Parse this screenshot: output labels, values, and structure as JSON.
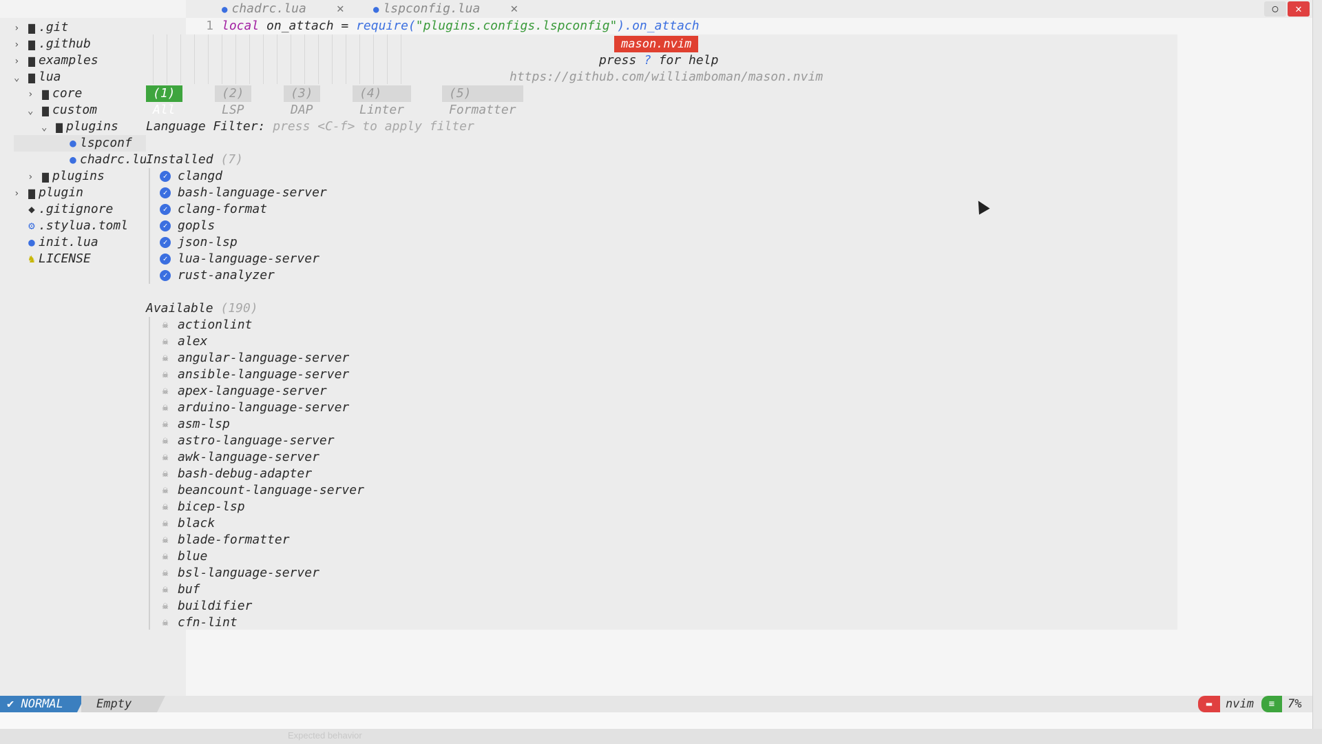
{
  "tabs": [
    {
      "label": "chadrc.lua",
      "icon": "lua-icon",
      "close": "✕"
    },
    {
      "label": "lspconfig.lua",
      "icon": "lua-icon",
      "close": "✕"
    }
  ],
  "editor": {
    "line_number": "1",
    "code": {
      "keyword": "local",
      "var": " on_attach = ",
      "fn": "require(",
      "str": "\"plugins.configs.lspconfig\"",
      "rest": ").on_attach"
    }
  },
  "tree": [
    {
      "label": ".git",
      "arrow": "›",
      "icon": "folder-icon"
    },
    {
      "label": ".github",
      "arrow": "›",
      "icon": "folder-icon"
    },
    {
      "label": "examples",
      "arrow": "›",
      "icon": "folder-icon"
    },
    {
      "label": "lua",
      "arrow": "⌄",
      "icon": "folder-icon"
    },
    {
      "label": "core",
      "arrow": "›",
      "icon": "folder-icon"
    },
    {
      "label": "custom",
      "arrow": "⌄",
      "icon": "folder-icon"
    },
    {
      "label": "plugins",
      "arrow": "⌄",
      "icon": "folder-icon"
    },
    {
      "label": "lspconf",
      "arrow": "",
      "icon": "lua-icon"
    },
    {
      "label": "chadrc.lu",
      "arrow": "",
      "icon": "lua-icon"
    },
    {
      "label": "plugins",
      "arrow": "›",
      "icon": "folder-icon"
    },
    {
      "label": "plugin",
      "arrow": "›",
      "icon": "folder-icon"
    },
    {
      "label": ".gitignore",
      "arrow": "",
      "icon": "git-icon"
    },
    {
      "label": ".stylua.toml",
      "arrow": "",
      "icon": "gear-icon"
    },
    {
      "label": "init.lua",
      "arrow": "",
      "icon": "lua-icon"
    },
    {
      "label": "LICENSE",
      "arrow": "",
      "icon": "license-icon"
    }
  ],
  "mason": {
    "title": "mason.nvim",
    "help_prefix": "press ",
    "help_key": "?",
    "help_suffix": " for help",
    "url": "https://github.com/williamboman/mason.nvim",
    "tabs": [
      "(1) All",
      "(2) LSP",
      "(3) DAP",
      "(4) Linter",
      "(5) Formatter"
    ],
    "active_tab": 0,
    "filter_label": "Language Filter:",
    "filter_hint": "press <C-f> to apply filter",
    "installed_label": "Installed",
    "installed_count": "(7)",
    "installed": [
      "clangd",
      "bash-language-server",
      "clang-format",
      "gopls",
      "json-lsp",
      "lua-language-server",
      "rust-analyzer"
    ],
    "available_label": "Available",
    "available_count": "(190)",
    "available": [
      "actionlint",
      "alex",
      "angular-language-server",
      "ansible-language-server",
      "apex-language-server",
      "arduino-language-server",
      "asm-lsp",
      "astro-language-server",
      "awk-language-server",
      "bash-debug-adapter",
      "beancount-language-server",
      "bicep-lsp",
      "black",
      "blade-formatter",
      "blue",
      "bsl-language-server",
      "buf",
      "buildifier",
      "cfn-lint"
    ]
  },
  "statusline": {
    "mode": "NORMAL",
    "buffer": "Empty",
    "app": "nvim",
    "percent": "7%"
  },
  "footer": "Expected behavior",
  "colors": {
    "accent_blue": "#3b6fe0",
    "mode_blue": "#3b7fbf",
    "active_green": "#3ea53e",
    "title_red": "#e04030"
  }
}
